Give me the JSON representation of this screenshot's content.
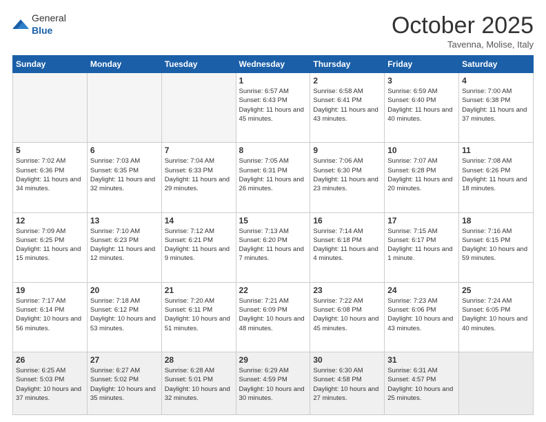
{
  "header": {
    "logo_general": "General",
    "logo_blue": "Blue",
    "title": "October 2025",
    "subtitle": "Tavenna, Molise, Italy"
  },
  "days_of_week": [
    "Sunday",
    "Monday",
    "Tuesday",
    "Wednesday",
    "Thursday",
    "Friday",
    "Saturday"
  ],
  "weeks": [
    [
      {
        "day": "",
        "empty": true
      },
      {
        "day": "",
        "empty": true
      },
      {
        "day": "",
        "empty": true
      },
      {
        "day": "1",
        "sunrise": "6:57 AM",
        "sunset": "6:43 PM",
        "daylight": "11 hours and 45 minutes."
      },
      {
        "day": "2",
        "sunrise": "6:58 AM",
        "sunset": "6:41 PM",
        "daylight": "11 hours and 43 minutes."
      },
      {
        "day": "3",
        "sunrise": "6:59 AM",
        "sunset": "6:40 PM",
        "daylight": "11 hours and 40 minutes."
      },
      {
        "day": "4",
        "sunrise": "7:00 AM",
        "sunset": "6:38 PM",
        "daylight": "11 hours and 37 minutes."
      }
    ],
    [
      {
        "day": "5",
        "sunrise": "7:02 AM",
        "sunset": "6:36 PM",
        "daylight": "11 hours and 34 minutes."
      },
      {
        "day": "6",
        "sunrise": "7:03 AM",
        "sunset": "6:35 PM",
        "daylight": "11 hours and 32 minutes."
      },
      {
        "day": "7",
        "sunrise": "7:04 AM",
        "sunset": "6:33 PM",
        "daylight": "11 hours and 29 minutes."
      },
      {
        "day": "8",
        "sunrise": "7:05 AM",
        "sunset": "6:31 PM",
        "daylight": "11 hours and 26 minutes."
      },
      {
        "day": "9",
        "sunrise": "7:06 AM",
        "sunset": "6:30 PM",
        "daylight": "11 hours and 23 minutes."
      },
      {
        "day": "10",
        "sunrise": "7:07 AM",
        "sunset": "6:28 PM",
        "daylight": "11 hours and 20 minutes."
      },
      {
        "day": "11",
        "sunrise": "7:08 AM",
        "sunset": "6:26 PM",
        "daylight": "11 hours and 18 minutes."
      }
    ],
    [
      {
        "day": "12",
        "sunrise": "7:09 AM",
        "sunset": "6:25 PM",
        "daylight": "11 hours and 15 minutes."
      },
      {
        "day": "13",
        "sunrise": "7:10 AM",
        "sunset": "6:23 PM",
        "daylight": "11 hours and 12 minutes."
      },
      {
        "day": "14",
        "sunrise": "7:12 AM",
        "sunset": "6:21 PM",
        "daylight": "11 hours and 9 minutes."
      },
      {
        "day": "15",
        "sunrise": "7:13 AM",
        "sunset": "6:20 PM",
        "daylight": "11 hours and 7 minutes."
      },
      {
        "day": "16",
        "sunrise": "7:14 AM",
        "sunset": "6:18 PM",
        "daylight": "11 hours and 4 minutes."
      },
      {
        "day": "17",
        "sunrise": "7:15 AM",
        "sunset": "6:17 PM",
        "daylight": "11 hours and 1 minute."
      },
      {
        "day": "18",
        "sunrise": "7:16 AM",
        "sunset": "6:15 PM",
        "daylight": "10 hours and 59 minutes."
      }
    ],
    [
      {
        "day": "19",
        "sunrise": "7:17 AM",
        "sunset": "6:14 PM",
        "daylight": "10 hours and 56 minutes."
      },
      {
        "day": "20",
        "sunrise": "7:18 AM",
        "sunset": "6:12 PM",
        "daylight": "10 hours and 53 minutes."
      },
      {
        "day": "21",
        "sunrise": "7:20 AM",
        "sunset": "6:11 PM",
        "daylight": "10 hours and 51 minutes."
      },
      {
        "day": "22",
        "sunrise": "7:21 AM",
        "sunset": "6:09 PM",
        "daylight": "10 hours and 48 minutes."
      },
      {
        "day": "23",
        "sunrise": "7:22 AM",
        "sunset": "6:08 PM",
        "daylight": "10 hours and 45 minutes."
      },
      {
        "day": "24",
        "sunrise": "7:23 AM",
        "sunset": "6:06 PM",
        "daylight": "10 hours and 43 minutes."
      },
      {
        "day": "25",
        "sunrise": "7:24 AM",
        "sunset": "6:05 PM",
        "daylight": "10 hours and 40 minutes."
      }
    ],
    [
      {
        "day": "26",
        "sunrise": "6:25 AM",
        "sunset": "5:03 PM",
        "daylight": "10 hours and 37 minutes.",
        "last": true
      },
      {
        "day": "27",
        "sunrise": "6:27 AM",
        "sunset": "5:02 PM",
        "daylight": "10 hours and 35 minutes.",
        "last": true
      },
      {
        "day": "28",
        "sunrise": "6:28 AM",
        "sunset": "5:01 PM",
        "daylight": "10 hours and 32 minutes.",
        "last": true
      },
      {
        "day": "29",
        "sunrise": "6:29 AM",
        "sunset": "4:59 PM",
        "daylight": "10 hours and 30 minutes.",
        "last": true
      },
      {
        "day": "30",
        "sunrise": "6:30 AM",
        "sunset": "4:58 PM",
        "daylight": "10 hours and 27 minutes.",
        "last": true
      },
      {
        "day": "31",
        "sunrise": "6:31 AM",
        "sunset": "4:57 PM",
        "daylight": "10 hours and 25 minutes.",
        "last": true
      },
      {
        "day": "",
        "empty": true,
        "last": true
      }
    ]
  ]
}
